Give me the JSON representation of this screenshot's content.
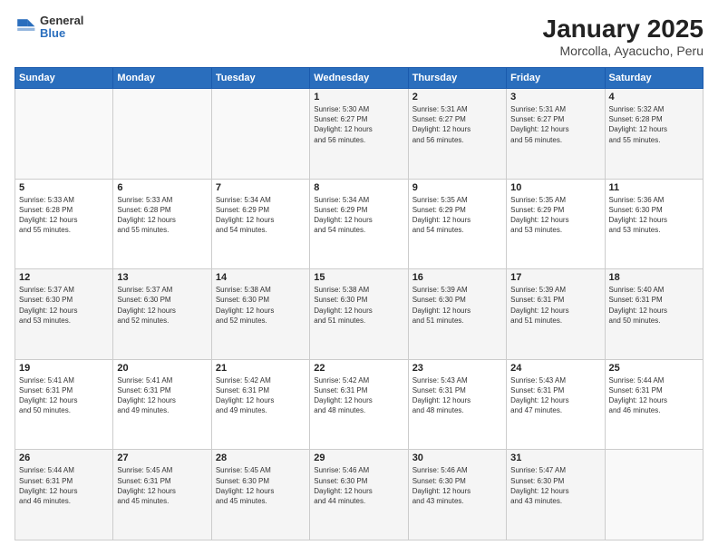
{
  "logo": {
    "line1": "General",
    "line2": "Blue"
  },
  "title": "January 2025",
  "subtitle": "Morcolla, Ayacucho, Peru",
  "days_header": [
    "Sunday",
    "Monday",
    "Tuesday",
    "Wednesday",
    "Thursday",
    "Friday",
    "Saturday"
  ],
  "weeks": [
    [
      {
        "num": "",
        "info": ""
      },
      {
        "num": "",
        "info": ""
      },
      {
        "num": "",
        "info": ""
      },
      {
        "num": "1",
        "info": "Sunrise: 5:30 AM\nSunset: 6:27 PM\nDaylight: 12 hours\nand 56 minutes."
      },
      {
        "num": "2",
        "info": "Sunrise: 5:31 AM\nSunset: 6:27 PM\nDaylight: 12 hours\nand 56 minutes."
      },
      {
        "num": "3",
        "info": "Sunrise: 5:31 AM\nSunset: 6:27 PM\nDaylight: 12 hours\nand 56 minutes."
      },
      {
        "num": "4",
        "info": "Sunrise: 5:32 AM\nSunset: 6:28 PM\nDaylight: 12 hours\nand 55 minutes."
      }
    ],
    [
      {
        "num": "5",
        "info": "Sunrise: 5:33 AM\nSunset: 6:28 PM\nDaylight: 12 hours\nand 55 minutes."
      },
      {
        "num": "6",
        "info": "Sunrise: 5:33 AM\nSunset: 6:28 PM\nDaylight: 12 hours\nand 55 minutes."
      },
      {
        "num": "7",
        "info": "Sunrise: 5:34 AM\nSunset: 6:29 PM\nDaylight: 12 hours\nand 54 minutes."
      },
      {
        "num": "8",
        "info": "Sunrise: 5:34 AM\nSunset: 6:29 PM\nDaylight: 12 hours\nand 54 minutes."
      },
      {
        "num": "9",
        "info": "Sunrise: 5:35 AM\nSunset: 6:29 PM\nDaylight: 12 hours\nand 54 minutes."
      },
      {
        "num": "10",
        "info": "Sunrise: 5:35 AM\nSunset: 6:29 PM\nDaylight: 12 hours\nand 53 minutes."
      },
      {
        "num": "11",
        "info": "Sunrise: 5:36 AM\nSunset: 6:30 PM\nDaylight: 12 hours\nand 53 minutes."
      }
    ],
    [
      {
        "num": "12",
        "info": "Sunrise: 5:37 AM\nSunset: 6:30 PM\nDaylight: 12 hours\nand 53 minutes."
      },
      {
        "num": "13",
        "info": "Sunrise: 5:37 AM\nSunset: 6:30 PM\nDaylight: 12 hours\nand 52 minutes."
      },
      {
        "num": "14",
        "info": "Sunrise: 5:38 AM\nSunset: 6:30 PM\nDaylight: 12 hours\nand 52 minutes."
      },
      {
        "num": "15",
        "info": "Sunrise: 5:38 AM\nSunset: 6:30 PM\nDaylight: 12 hours\nand 51 minutes."
      },
      {
        "num": "16",
        "info": "Sunrise: 5:39 AM\nSunset: 6:30 PM\nDaylight: 12 hours\nand 51 minutes."
      },
      {
        "num": "17",
        "info": "Sunrise: 5:39 AM\nSunset: 6:31 PM\nDaylight: 12 hours\nand 51 minutes."
      },
      {
        "num": "18",
        "info": "Sunrise: 5:40 AM\nSunset: 6:31 PM\nDaylight: 12 hours\nand 50 minutes."
      }
    ],
    [
      {
        "num": "19",
        "info": "Sunrise: 5:41 AM\nSunset: 6:31 PM\nDaylight: 12 hours\nand 50 minutes."
      },
      {
        "num": "20",
        "info": "Sunrise: 5:41 AM\nSunset: 6:31 PM\nDaylight: 12 hours\nand 49 minutes."
      },
      {
        "num": "21",
        "info": "Sunrise: 5:42 AM\nSunset: 6:31 PM\nDaylight: 12 hours\nand 49 minutes."
      },
      {
        "num": "22",
        "info": "Sunrise: 5:42 AM\nSunset: 6:31 PM\nDaylight: 12 hours\nand 48 minutes."
      },
      {
        "num": "23",
        "info": "Sunrise: 5:43 AM\nSunset: 6:31 PM\nDaylight: 12 hours\nand 48 minutes."
      },
      {
        "num": "24",
        "info": "Sunrise: 5:43 AM\nSunset: 6:31 PM\nDaylight: 12 hours\nand 47 minutes."
      },
      {
        "num": "25",
        "info": "Sunrise: 5:44 AM\nSunset: 6:31 PM\nDaylight: 12 hours\nand 46 minutes."
      }
    ],
    [
      {
        "num": "26",
        "info": "Sunrise: 5:44 AM\nSunset: 6:31 PM\nDaylight: 12 hours\nand 46 minutes."
      },
      {
        "num": "27",
        "info": "Sunrise: 5:45 AM\nSunset: 6:31 PM\nDaylight: 12 hours\nand 45 minutes."
      },
      {
        "num": "28",
        "info": "Sunrise: 5:45 AM\nSunset: 6:30 PM\nDaylight: 12 hours\nand 45 minutes."
      },
      {
        "num": "29",
        "info": "Sunrise: 5:46 AM\nSunset: 6:30 PM\nDaylight: 12 hours\nand 44 minutes."
      },
      {
        "num": "30",
        "info": "Sunrise: 5:46 AM\nSunset: 6:30 PM\nDaylight: 12 hours\nand 43 minutes."
      },
      {
        "num": "31",
        "info": "Sunrise: 5:47 AM\nSunset: 6:30 PM\nDaylight: 12 hours\nand 43 minutes."
      },
      {
        "num": "",
        "info": ""
      }
    ]
  ]
}
